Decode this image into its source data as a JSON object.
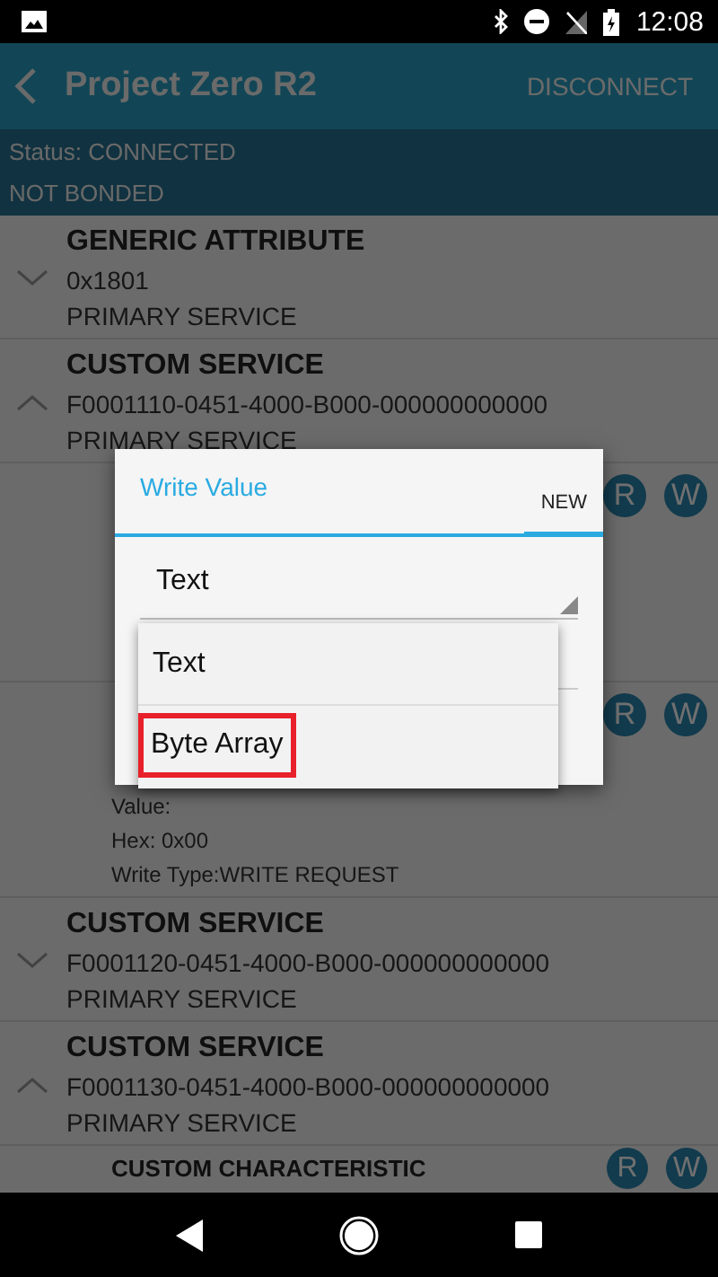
{
  "status_bar": {
    "time": "12:08"
  },
  "app_bar": {
    "title": "Project Zero R2",
    "action": "DISCONNECT"
  },
  "connection": {
    "status": "Status: CONNECTED",
    "bond": "NOT BONDED"
  },
  "items": [
    {
      "kind": "service",
      "name": "GENERIC ATTRIBUTE",
      "uuid": "0x1801",
      "type": "PRIMARY SERVICE",
      "expanded": false
    },
    {
      "kind": "service",
      "name": "CUSTOM SERVICE",
      "uuid": "F0001110-0451-4000-B000-000000000000",
      "type": "PRIMARY SERVICE",
      "expanded": true
    },
    {
      "kind": "characteristic",
      "read_button": "R",
      "write_button": "W"
    },
    {
      "kind": "characteristic",
      "read_button": "R",
      "write_button": "W",
      "lines": [
        "Value:",
        "Hex: 0x00",
        "Write Type:WRITE REQUEST"
      ]
    },
    {
      "kind": "service",
      "name": "CUSTOM SERVICE",
      "uuid": "F0001120-0451-4000-B000-000000000000",
      "type": "PRIMARY SERVICE",
      "expanded": false
    },
    {
      "kind": "service",
      "name": "CUSTOM SERVICE",
      "uuid": "F0001130-0451-4000-B000-000000000000",
      "type": "PRIMARY SERVICE",
      "expanded": true
    },
    {
      "kind": "characteristic",
      "name": "CUSTOM CHARACTERISTIC",
      "read_button": "R",
      "write_button": "W"
    }
  ],
  "dialog": {
    "title": "Write Value",
    "tab": "NEW",
    "format_value": "Text",
    "options": [
      {
        "label": "Text",
        "highlighted": false
      },
      {
        "label": "Byte Array",
        "highlighted": true
      }
    ]
  }
}
